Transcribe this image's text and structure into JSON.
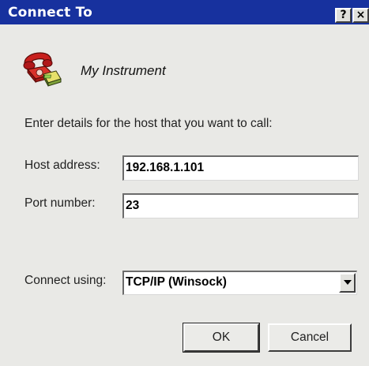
{
  "window": {
    "title": "Connect To",
    "help_glyph": "?",
    "close_glyph": "×"
  },
  "connection": {
    "name": "My Instrument",
    "icon": "phone-connection-icon"
  },
  "prompt": "Enter details for the host that you want to call:",
  "fields": {
    "host_label": "Host address:",
    "host_value": "192.168.1.101",
    "port_label": "Port number:",
    "port_value": "23",
    "connect_label": "Connect using:",
    "connect_value": "TCP/IP (Winsock)"
  },
  "buttons": {
    "ok": "OK",
    "cancel": "Cancel"
  },
  "colors": {
    "titlebar": "#17319e",
    "dialog_bg": "#e9e9e6"
  }
}
